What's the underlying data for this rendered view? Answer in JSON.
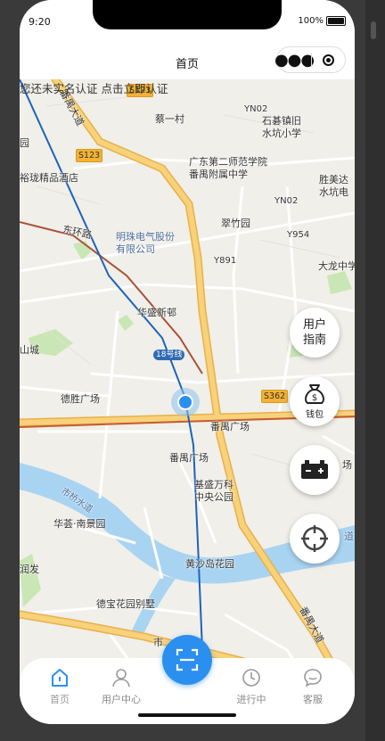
{
  "status": {
    "time": "9:20",
    "battery": "100%"
  },
  "nav": {
    "title": "首页"
  },
  "map": {
    "notice": "您还未实名认证 点击立即认证",
    "labels": {
      "cai_yi_cun": "蔡一村",
      "yn02_a": "YN02",
      "shijiao": "石碁镇旧\n水坑小学",
      "yu_long": "裕珑精品酒店",
      "yuan": "园",
      "gd_normal": "广东第二师范学院\n番禺附属中学",
      "yn02_b": "YN02",
      "shengmeida": "胜美达\n水坑电",
      "cuizhu": "翠竹园",
      "dong_huan": "东环路",
      "mingzhu": "明珠电气股份\n有限公司",
      "y954": "Y954",
      "y891": "Y891",
      "dalong": "大龙中学",
      "huasheng": "华盛新邨",
      "shan_cheng": "山城",
      "desheng": "德胜广场",
      "panyu_square_1": "番禺广场",
      "panyu_square_2": "番禺广场",
      "jicheng": "基盛万科\n中央公园",
      "huahui": "华荟·南景园",
      "run_fa": "润发",
      "huangsha": "黄沙岛花园",
      "debao": "德宝花园别墅",
      "panyu_dadao_a": "番禺大道",
      "panyu_dadao_b": "番禺大道",
      "shi_qiao": "市桥水道",
      "shi": "市",
      "chang": "场",
      "dao": "道"
    },
    "badges": {
      "s123_a": "S123",
      "s123_b": "S123",
      "s362": "S362",
      "line18": "18号线"
    }
  },
  "fabs": {
    "user_guide": "用户\n指南",
    "wallet": "钱包"
  },
  "tabs": [
    {
      "label": "首页",
      "icon": "home-icon",
      "active": true
    },
    {
      "label": "用户中心",
      "icon": "user-icon",
      "active": false
    },
    {
      "label": "进行中",
      "icon": "clock-icon",
      "active": false
    },
    {
      "label": "客服",
      "icon": "chat-icon",
      "active": false
    }
  ],
  "colors": {
    "accent": "#2b8ff0",
    "map_bg": "#f0efe9",
    "road_main": "#f7d27a",
    "water": "#a8d4f2"
  }
}
